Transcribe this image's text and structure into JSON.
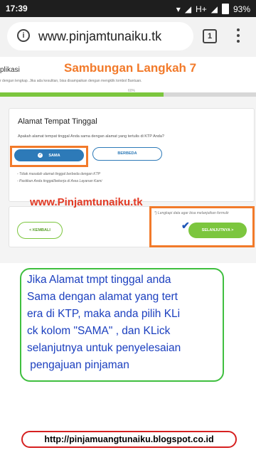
{
  "status_bar": {
    "time": "17:39",
    "network": "H+",
    "battery": "93%"
  },
  "browser": {
    "url": "www.pinjamtunaiku.tk",
    "tab_count": "1"
  },
  "page": {
    "title": "plikasi",
    "subtitle": "r dengan lengkap. Jika ada kesulitan, bisa disampaikan dengan mengklik tombol Bantuan.",
    "progress_label": "60%",
    "progress_value": 0.64
  },
  "overlay": {
    "step_title": "Sambungan Langkah 7",
    "watermark": "www.Pinjamtunaiku.tk",
    "instruction_lines": [
      "Jika Alamat tmpt tinggal anda",
      "Sama dengan alamat yang tert",
      "era di KTP, maka anda pilih KLi",
      "ck  kolom \"SAMA\" , dan KLick",
      "selanjutnya untuk penyelesaian",
      " pengajuan pinjaman"
    ],
    "footer_link": "http://pinjamuangtunaiku.blogspot.co.id"
  },
  "card": {
    "title": "Alamat Tempat Tinggal",
    "question": "Apakah alamat tempat tinggal Anda sama dengan alamat yang tertulis di KTP Anda?",
    "options": {
      "same": "SAMA",
      "different": "BERBEDA"
    },
    "notes": [
      "- Tidak masalah alamat tinggal berbeda dengan KTP",
      "- Pastikan Anda tinggal/bekerja di Area Layanan Kami"
    ]
  },
  "navigation": {
    "back_label": "< KEMBALI",
    "next_note": "*) Lengkapi data agar bisa melanjutkan formulir",
    "next_label": "SELANJUTNYA >"
  },
  "colors": {
    "accent_orange": "#f27a2a",
    "primary_blue": "#2d7ab8",
    "success_green": "#7cc63e",
    "instruction_blue": "#1b3fbf"
  }
}
